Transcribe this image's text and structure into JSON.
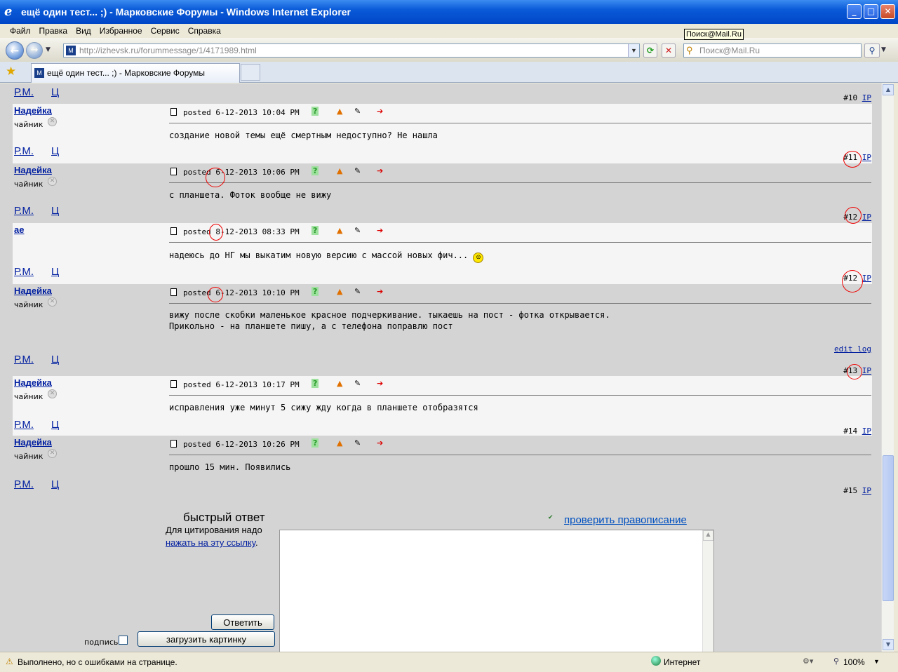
{
  "window": {
    "title": "ещё один тест... ;) - Марковские Форумы - Windows Internet Explorer"
  },
  "menu": [
    "Файл",
    "Правка",
    "Вид",
    "Избранное",
    "Сервис",
    "Справка"
  ],
  "address": {
    "url": "http://izhevsk.ru/forummessage/1/4171989.html"
  },
  "search": {
    "placeholder": "Поиск@Mail.Ru",
    "tooltip": "Поиск@Mail.Ru"
  },
  "tab": {
    "title": "ещё один тест... ;) - Марковские Форумы"
  },
  "post_links": {
    "rm": "Р.М.",
    "c": "Ц",
    "ip": "IP",
    "edit_log": "edit log"
  },
  "top_partial": {
    "number": "#10"
  },
  "posts": [
    {
      "user": "Надейка",
      "role": "чайник",
      "posted": "posted 6-12-2013 10:04 PM",
      "text": [
        "создание новой темы ещё смертным недоступно? Не нашла"
      ],
      "number": "#11"
    },
    {
      "user": "Надейка",
      "role": "чайник",
      "posted": "posted 6-12-2013 10:06 PM",
      "text": [
        "с планшета. Фоток вообще не вижу"
      ],
      "number": "#12"
    },
    {
      "user": "ae",
      "role": "",
      "posted": "posted 8-12-2013 08:33 PM",
      "text": [
        "надеюсь до НГ мы выкатим новую версию с массой новых фич... "
      ],
      "number": "#12"
    },
    {
      "user": "Надейка",
      "role": "чайник",
      "posted": "posted 6-12-2013 10:10 PM",
      "text": [
        "вижу после скобки маленькое красное подчеркивание. тыкаешь на пост - фотка открывается.",
        "Прикольно - на планшете пишу, а с телефона поправлю пост"
      ],
      "number": "#13"
    },
    {
      "user": "Надейка",
      "role": "чайник",
      "posted": "posted 6-12-2013 10:17 PM",
      "text": [
        "исправления уже минут 5 сижу жду когда в планшете отобразятся"
      ],
      "number": "#14"
    },
    {
      "user": "Надейка",
      "role": "чайник",
      "posted": "posted 6-12-2013 10:26 PM",
      "text": [
        "прошло 15 мин. Появились"
      ],
      "number": "#15"
    }
  ],
  "quick_reply": {
    "title": "быстрый ответ",
    "spellcheck": "проверить правописание",
    "quote_hint": "Для цитирования надо",
    "quote_link": "нажать на эту ссылку",
    "quote_end": ".",
    "reply_button": "Ответить",
    "upload_button": "загрузить картинку",
    "signature_label": "подпись"
  },
  "status": {
    "text": "Выполнено, но с ошибками на странице.",
    "zone": "Интернет",
    "zoom": "100%"
  }
}
